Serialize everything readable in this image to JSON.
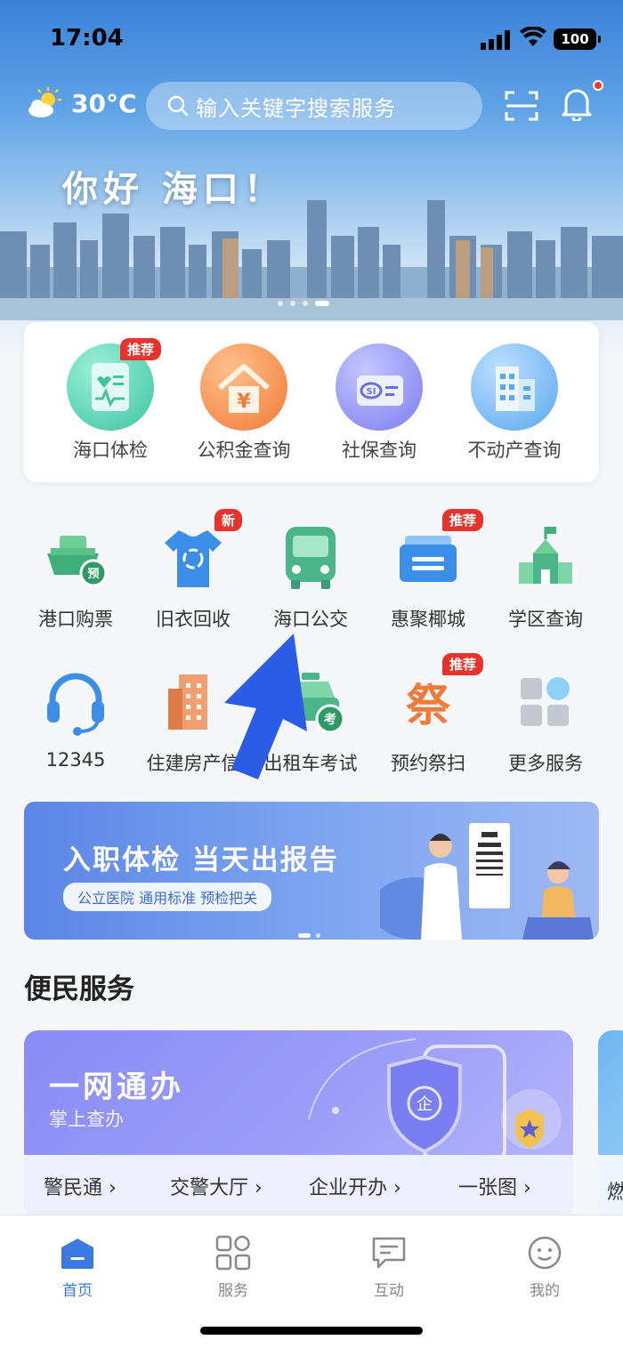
{
  "status_bar": {
    "time": "17:04",
    "battery": "100"
  },
  "header": {
    "temperature": "30°C",
    "search_placeholder": "输入关键字搜索服务",
    "greeting": "你好  海口！"
  },
  "featured": [
    {
      "label": "海口体检",
      "badge": "推荐",
      "icon": "health-report-icon"
    },
    {
      "label": "公积金查询",
      "icon": "housing-fund-icon"
    },
    {
      "label": "社保查询",
      "icon": "social-security-card-icon"
    },
    {
      "label": "不动产查询",
      "icon": "building-icon"
    }
  ],
  "grid": [
    {
      "label": "港口购票",
      "icon": "ferry-ticket-icon"
    },
    {
      "label": "旧衣回收",
      "badge": "新",
      "icon": "clothes-recycle-icon"
    },
    {
      "label": "海口公交",
      "icon": "bus-icon"
    },
    {
      "label": "惠聚椰城",
      "badge": "推荐",
      "icon": "coupon-icon"
    },
    {
      "label": "学区查询",
      "icon": "school-icon"
    },
    {
      "label": "12345",
      "icon": "headset-icon"
    },
    {
      "label": "住建房产信",
      "icon": "residential-building-icon"
    },
    {
      "label": "出租车考试",
      "icon": "taxi-exam-icon"
    },
    {
      "label": "预约祭扫",
      "badge": "推荐",
      "icon": "memorial-icon"
    },
    {
      "label": "更多服务",
      "icon": "more-services-icon"
    }
  ],
  "ad_banner": {
    "title": "入职体检  当天出报告",
    "pill": "公立医院  通用标准 预检把关"
  },
  "section_title": "便民服务",
  "service_card": {
    "title": "一网通办",
    "subtitle": "掌上查办",
    "links": [
      "警民通 ›",
      "交警大厅 ›",
      "企业开办 ›",
      "一张图 ›"
    ],
    "peek_text": "燃"
  },
  "tabbar": [
    {
      "label": "首页",
      "icon": "home-icon",
      "active": true
    },
    {
      "label": "服务",
      "icon": "grid-icon"
    },
    {
      "label": "互动",
      "icon": "message-icon"
    },
    {
      "label": "我的",
      "icon": "profile-icon"
    }
  ],
  "colors": {
    "accent": "#3a7ae0",
    "badge": "#e8332c",
    "arrow": "#2b5ce6"
  }
}
